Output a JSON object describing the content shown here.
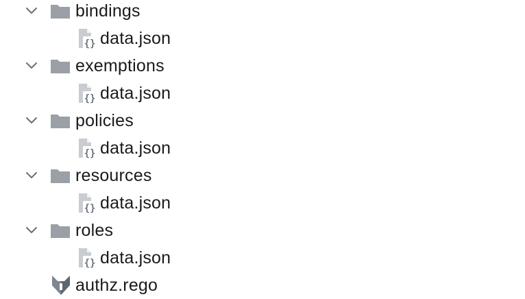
{
  "tree": {
    "folders": [
      {
        "name": "bindings",
        "expanded": true,
        "children": [
          "data.json"
        ]
      },
      {
        "name": "exemptions",
        "expanded": true,
        "children": [
          "data.json"
        ]
      },
      {
        "name": "policies",
        "expanded": true,
        "children": [
          "data.json"
        ]
      },
      {
        "name": "resources",
        "expanded": true,
        "children": [
          "data.json"
        ]
      },
      {
        "name": "roles",
        "expanded": true,
        "children": [
          "data.json"
        ]
      }
    ],
    "files": [
      {
        "name": "authz.rego",
        "icon": "opa-rego-icon"
      }
    ]
  },
  "icons": {
    "folder": "folder-icon",
    "json": "json-file-icon",
    "chevron": "chevron-down-icon"
  },
  "colors": {
    "folder": "#9aa0a6",
    "chevron": "#6e6e6e",
    "text": "#1a1a1a",
    "json_icon": "#8c9198",
    "rego_icon": "#5e6670"
  }
}
